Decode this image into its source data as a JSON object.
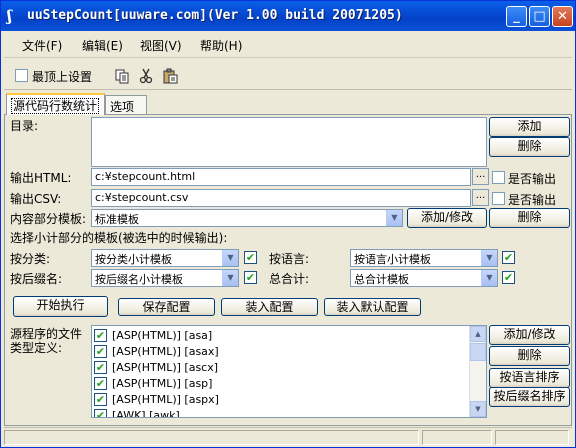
{
  "window": {
    "title": "uuStepCount[uuware.com](Ver 1.00 build 20071205)",
    "icon_glyph": "ʃ",
    "minimize_glyph": "_",
    "maximize_glyph": "□",
    "close_glyph": "✕"
  },
  "menu": [
    "文件(F)",
    "编辑(E)",
    "视图(V)",
    "帮助(H)"
  ],
  "toolbar": {
    "topmost_label": "最顶上设置",
    "topmost_checked": false,
    "icons": [
      "copy-icon",
      "cut-icon",
      "paste-icon"
    ]
  },
  "tabs": [
    "源代码行数统计",
    "选项"
  ],
  "form": {
    "dir_label": "目录:",
    "dir_value": "",
    "add_label": "添加",
    "delete_label": "删除",
    "html_label": "输出HTML:",
    "html_value": "c:¥stepcount.html",
    "html_output_label": "是否输出",
    "csv_label": "输出CSV:",
    "csv_value": "c:¥stepcount.csv",
    "csv_output_label": "是否输出",
    "browse_glyph": "...",
    "content_template_label": "内容部分模板:",
    "content_template_value": "标准模板",
    "add_modify_label": "添加/修改",
    "delete2_label": "删除",
    "subtotal_label": "选择小计部分的模板(被选中的时候输出):",
    "by_category_label": "按分类:",
    "by_category_value": "按分类小计模板",
    "by_language_label": "按语言:",
    "by_language_value": "按语言小计模板",
    "by_ext_label": "按后缀名:",
    "by_ext_value": "按后缀名小计模板",
    "total_label": "总合计:",
    "total_value": "总合计模板",
    "check_glyph": "✔",
    "start_label": "开始执行",
    "save_config_label": "保存配置",
    "load_config_label": "装入配置",
    "load_default_label": "装入默认配置",
    "filetype_label_1": "源程序的文件",
    "filetype_label_2": "类型定义:",
    "filetypes": [
      "[ASP(HTML)] [asa]",
      "[ASP(HTML)] [asax]",
      "[ASP(HTML)] [ascx]",
      "[ASP(HTML)] [asp]",
      "[ASP(HTML)] [aspx]",
      "[AWK] [awk]"
    ],
    "ft_add_modify_label": "添加/修改",
    "ft_delete_label": "删除",
    "sort_by_lang_label": "按语言排序",
    "sort_by_ext_label": "按后缀名排序"
  }
}
